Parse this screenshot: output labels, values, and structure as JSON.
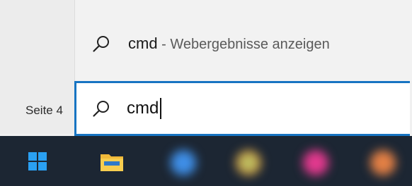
{
  "status_bar": {
    "page_text": "Seite 4"
  },
  "suggestion": {
    "query": "cmd",
    "separator": " - ",
    "description": "Webergebnisse anzeigen"
  },
  "search": {
    "value": "cmd"
  },
  "taskbar": {
    "apps": [
      {
        "icon": "start-windows-icon"
      },
      {
        "icon": "file-explorer-icon"
      },
      {
        "icon": "app-icon-blue",
        "color": "#3f8fe8"
      },
      {
        "icon": "app-icon-chrome",
        "color": "#d8a042"
      },
      {
        "icon": "app-icon-pink",
        "color": "#e2398e"
      },
      {
        "icon": "app-icon-orange",
        "color": "#e38045"
      }
    ]
  },
  "colors": {
    "accent": "#1774c2",
    "taskbar": "#1c2633"
  }
}
